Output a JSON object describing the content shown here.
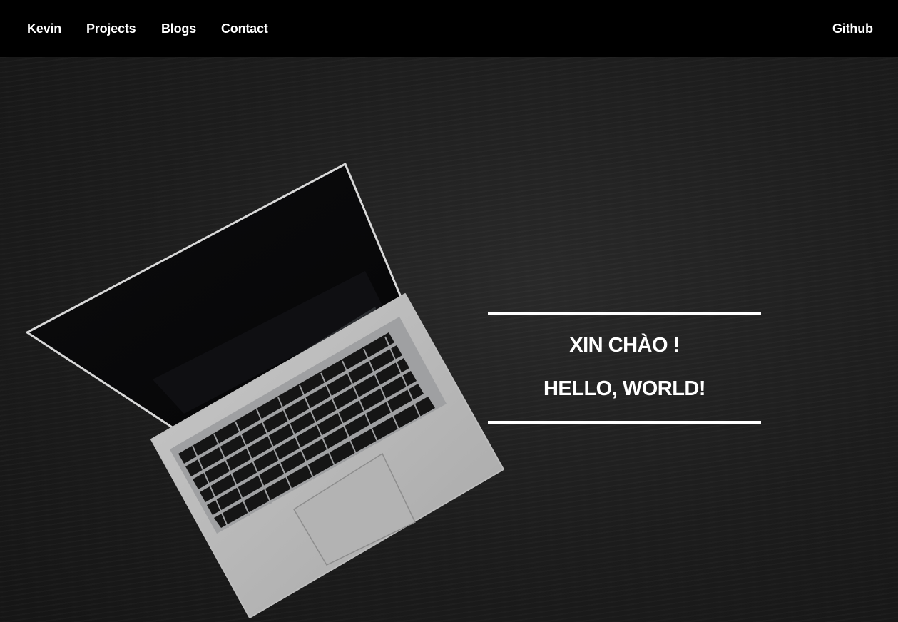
{
  "nav": {
    "brand": "Kevin",
    "links": [
      "Projects",
      "Blogs",
      "Contact"
    ],
    "github": "Github"
  },
  "hero": {
    "line1": "XIN CHÀO !",
    "line2": "HELLO, WORLD!",
    "image": "laptop-on-dark-desk-photo"
  },
  "colors": {
    "navbar_bg": "#000000",
    "hero_bg": "#1f1f1f",
    "text": "#ffffff"
  }
}
